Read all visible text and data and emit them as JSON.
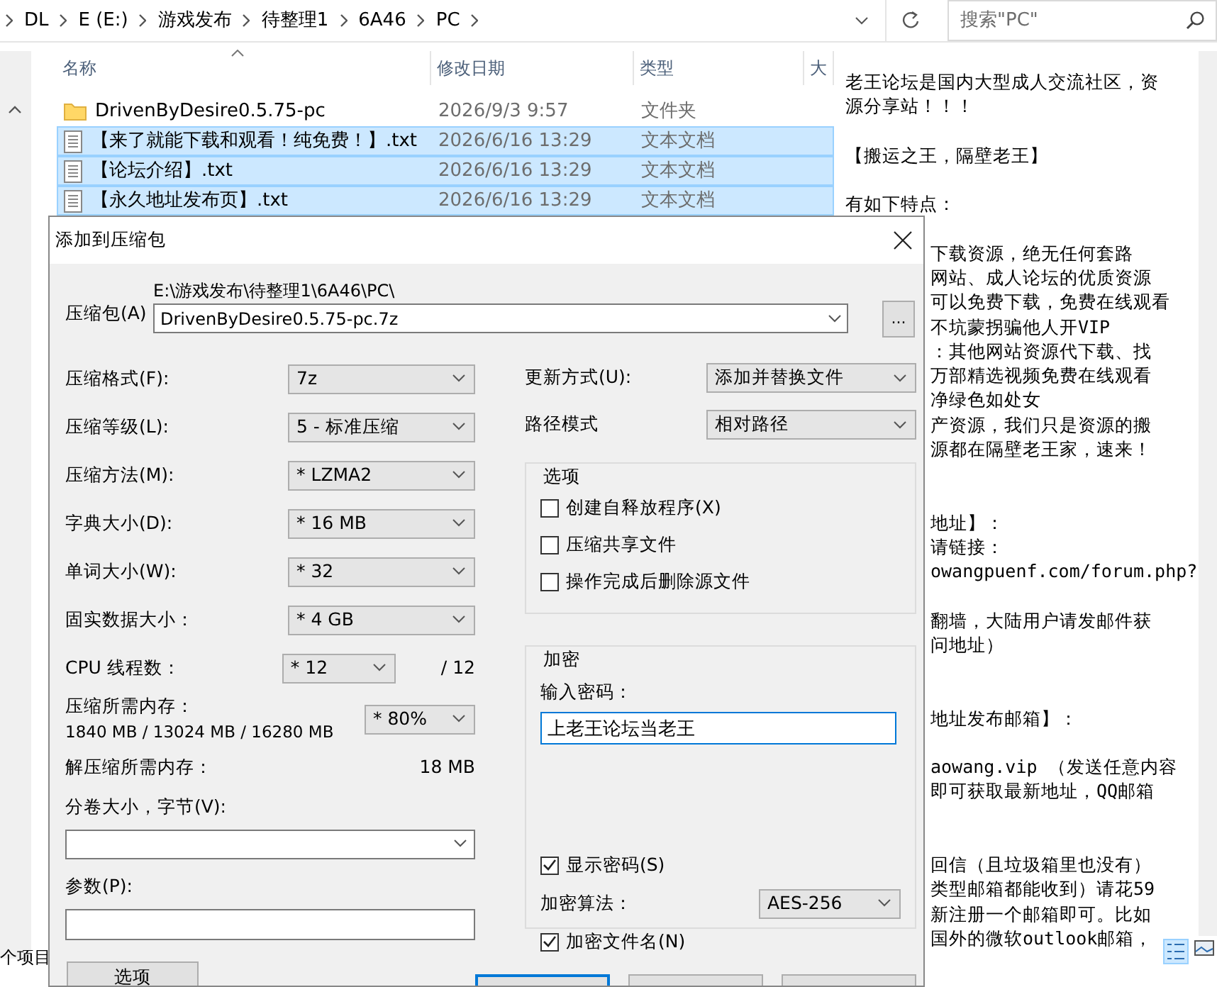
{
  "explorer": {
    "breadcrumb": [
      "DL",
      "E (E:)",
      "游戏发布",
      "待整理1",
      "6A46",
      "PC"
    ],
    "search": {
      "placeholder": "搜索\"PC\""
    },
    "columns": [
      "名称",
      "修改日期",
      "类型",
      "大"
    ],
    "rows": [
      {
        "kind": "folder",
        "name": "DrivenByDesire0.5.75-pc",
        "date": "2026/9/3 9:57",
        "type": "文件夹",
        "selected": false
      },
      {
        "kind": "text",
        "name": "【来了就能下载和观看！纯免费！】.txt",
        "date": "2026/6/16 13:29",
        "type": "文本文档",
        "selected": true
      },
      {
        "kind": "text",
        "name": "【论坛介绍】.txt",
        "date": "2026/6/16 13:29",
        "type": "文本文档",
        "selected": true
      },
      {
        "kind": "text",
        "name": "【永久地址发布页】.txt",
        "date": "2026/6/16 13:29",
        "type": "文本文档",
        "selected": true
      }
    ],
    "status_bar": "个项目"
  },
  "notepad": {
    "paragraphs": [
      {
        "kind": "paragraph",
        "lines": [
          "老王论坛是国内大型成人交流社区，资",
          "源分享站！！！"
        ]
      },
      {
        "kind": "paragraph",
        "lines": [
          "【搬运之王，隔壁老王】"
        ]
      },
      {
        "kind": "paragraph",
        "lines": [
          "有如下特点："
        ]
      },
      {
        "kind": "paragraph",
        "lines": [
          "下载资源，绝无任何套路",
          "网站、成人论坛的优质资源",
          "可以免费下载，免费在线观看",
          "不坑蒙拐骗他人开VIP",
          "：其他网站资源代下载、找",
          "万部精选视频免费在线观看",
          "净绿色如处女",
          "产资源，我们只是资源的搬",
          "源都在隔壁老王家，速来！"
        ]
      },
      {
        "kind": "section",
        "lines": [
          "地址】：",
          "请链接：",
          "owangpuenf.com/forum.php?"
        ]
      },
      {
        "kind": "paragraph",
        "lines": [
          "翻墙，大陆用户请发邮件获",
          "问地址）"
        ]
      },
      {
        "kind": "section",
        "lines": [
          "地址发布邮箱】："
        ]
      },
      {
        "kind": "paragraph",
        "lines": [
          "aowang.vip  （发送任意内容",
          "即可获取最新地址，QQ邮箱"
        ]
      },
      {
        "kind": "section",
        "lines": [
          "回信（且垃圾箱里也没有）",
          "类型邮箱都能收到）请花59",
          "新注册一个邮箱即可。比如",
          "国外的微软outlook邮箱，"
        ]
      }
    ]
  },
  "dialog": {
    "title": "添加到压缩包",
    "archive": {
      "label": "压缩包(A)",
      "path": "E:\\游戏发布\\待整理1\\6A46\\PC\\",
      "value": "DrivenByDesire0.5.75-pc.7z"
    },
    "browse_button": "...",
    "left_fields": [
      {
        "kind": "select",
        "label": "压缩格式(F):",
        "value": "7z"
      },
      {
        "kind": "select",
        "label": "压缩等级(L):",
        "value": "5 - 标准压缩"
      },
      {
        "kind": "select",
        "label": "压缩方法(M):",
        "value": "* LZMA2"
      },
      {
        "kind": "select",
        "label": "字典大小(D):",
        "value": "* 16 MB"
      },
      {
        "kind": "select",
        "label": "单词大小(W):",
        "value": "* 32"
      },
      {
        "kind": "select",
        "label": "固实数据大小：",
        "value": "* 4 GB"
      },
      {
        "kind": "threads",
        "label": "CPU 线程数：",
        "value": "* 12",
        "suffix": "/ 12"
      },
      {
        "kind": "memory",
        "label": "压缩所需内存：",
        "note": "1840 MB / 13024 MB / 16280 MB",
        "value": "* 80%"
      },
      {
        "kind": "info",
        "label": "解压缩所需内存：",
        "value": "18 MB"
      },
      {
        "kind": "combo",
        "label": "分卷大小，字节(V):"
      },
      {
        "kind": "input",
        "label": "参数(P):"
      }
    ],
    "options_button": "选项",
    "update": {
      "label": "更新方式(U):",
      "value": "添加并替换文件"
    },
    "path_mode": {
      "label": "路径模式",
      "value": "相对路径"
    },
    "options": {
      "title": "选项",
      "items": [
        {
          "label": "创建自释放程序(X)",
          "checked": false
        },
        {
          "label": "压缩共享文件",
          "checked": false
        },
        {
          "label": "操作完成后删除源文件",
          "checked": false
        }
      ]
    },
    "encryption": {
      "title": "加密",
      "password_label": "输入密码：",
      "password": "上老王论坛当老王",
      "show_password": {
        "label": "显示密码(S)",
        "checked": true
      },
      "method": {
        "label": "加密算法：",
        "value": "AES-256"
      },
      "encrypt_names": {
        "label": "加密文件名(N)",
        "checked": true
      }
    }
  }
}
